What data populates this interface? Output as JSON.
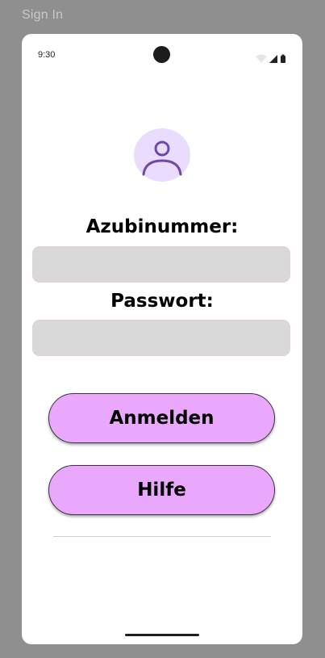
{
  "window": {
    "title": "Sign In"
  },
  "status_bar": {
    "time": "9:30",
    "icons": [
      "wifi-icon",
      "cellular-signal-icon",
      "battery-icon"
    ]
  },
  "avatar": {
    "icon": "user-icon"
  },
  "form": {
    "username_label": "Azubinummer:",
    "username_value": "",
    "password_label": "Passwort:",
    "password_value": ""
  },
  "buttons": {
    "login_label": "Anmelden",
    "help_label": "Hilfe"
  },
  "colors": {
    "background": "#8f8f8f",
    "screen": "#ffffff",
    "avatar_bg": "#eadcff",
    "avatar_icon": "#6e4aa8",
    "input_bg": "#d9d9d9",
    "button_bg": "#e9a8fc",
    "button_border": "#3a3440"
  }
}
